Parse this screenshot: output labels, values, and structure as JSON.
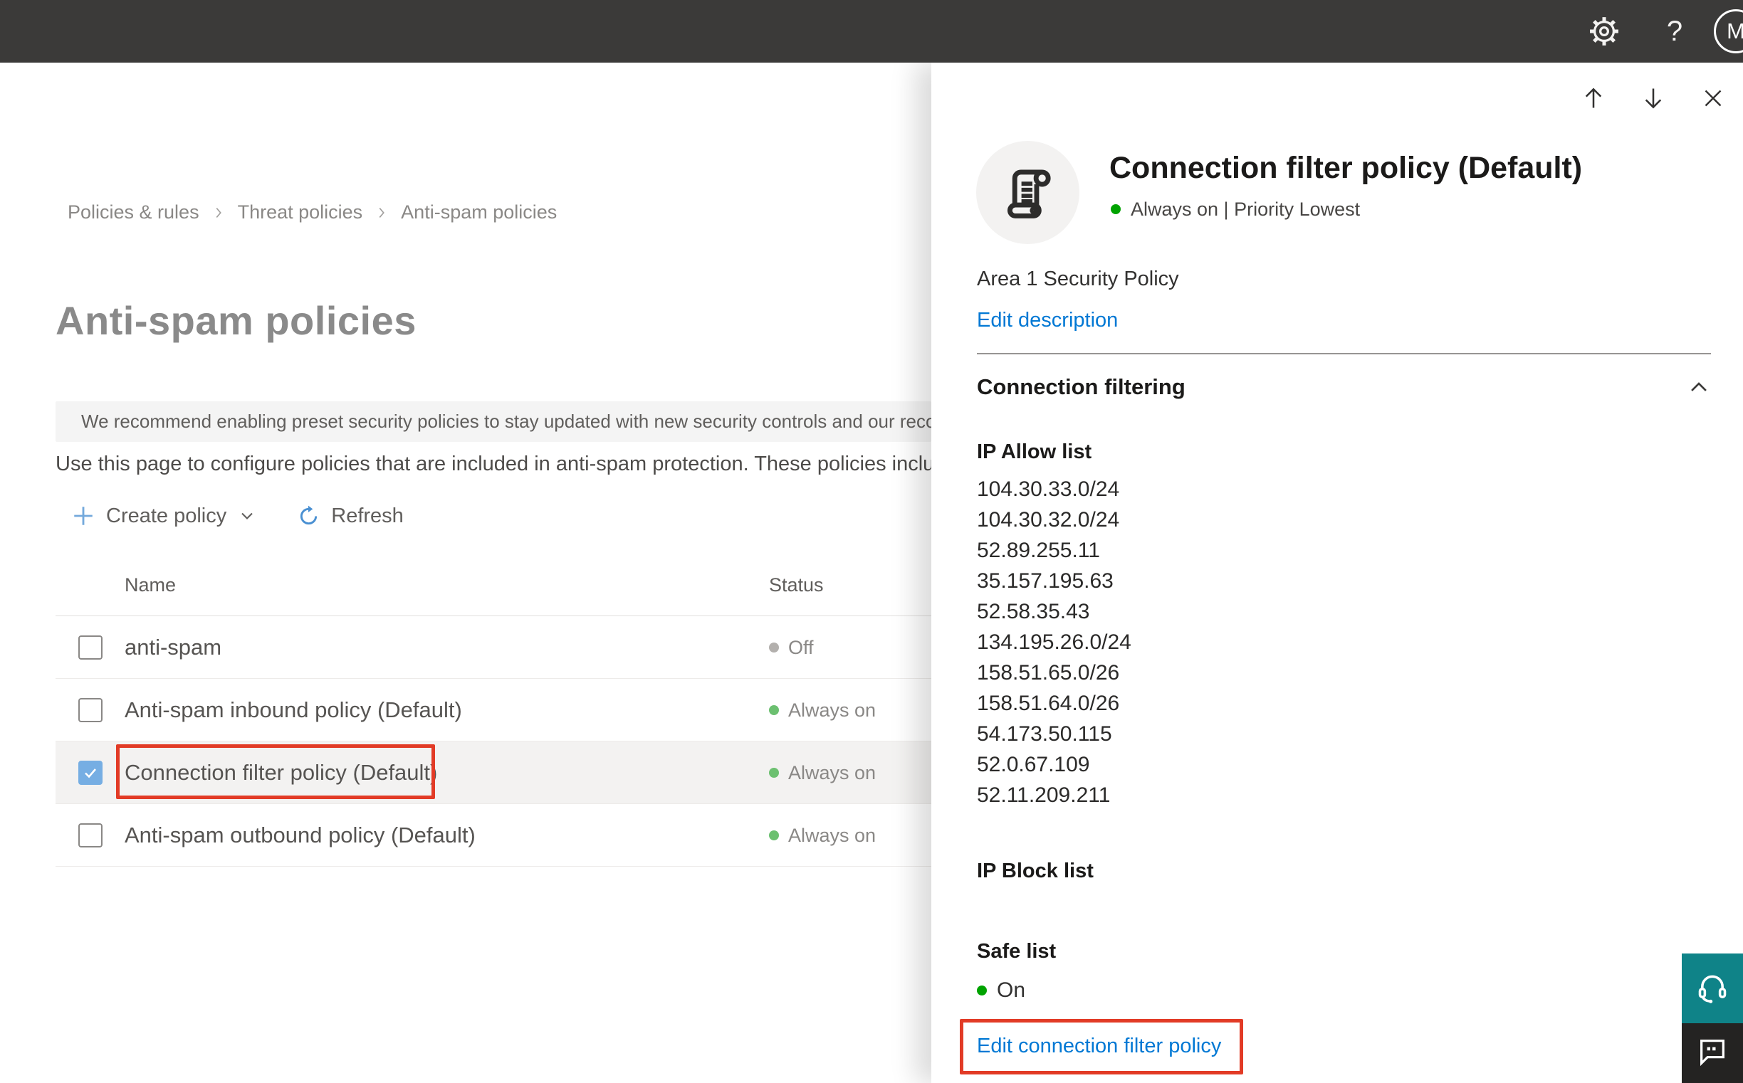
{
  "topbar": {
    "help_label": "?",
    "avatar_initial": "M"
  },
  "breadcrumb": {
    "items": [
      "Policies & rules",
      "Threat policies",
      "Anti-spam policies"
    ]
  },
  "page": {
    "title": "Anti-spam policies",
    "banner_text": "We recommend enabling preset security policies to stay updated with new security controls and our recomme",
    "description": "Use this page to configure policies that are included in anti-spam protection. These policies include"
  },
  "toolbar": {
    "create_label": "Create policy",
    "refresh_label": "Refresh"
  },
  "table": {
    "columns": {
      "name": "Name",
      "status": "Status"
    },
    "rows": [
      {
        "name": "anti-spam",
        "status": "Off",
        "state": "off",
        "checked": false,
        "annotated": false
      },
      {
        "name": "Anti-spam inbound policy (Default)",
        "status": "Always on",
        "state": "on",
        "checked": false,
        "annotated": false
      },
      {
        "name": "Connection filter policy (Default)",
        "status": "Always on",
        "state": "on",
        "checked": true,
        "annotated": true,
        "selected": true
      },
      {
        "name": "Anti-spam outbound policy (Default)",
        "status": "Always on",
        "state": "on",
        "checked": false,
        "annotated": false
      }
    ]
  },
  "panel": {
    "title": "Connection filter policy (Default)",
    "status_line": "Always on | Priority Lowest",
    "description": "Area 1 Security Policy",
    "edit_description_label": "Edit description",
    "section_title": "Connection filtering",
    "ip_allow": {
      "title": "IP Allow list",
      "items": [
        "104.30.33.0/24",
        "104.30.32.0/24",
        "52.89.255.11",
        "35.157.195.63",
        "52.58.35.43",
        "134.195.26.0/24",
        "158.51.65.0/26",
        "158.51.64.0/26",
        "54.173.50.115",
        "52.0.67.109",
        "52.11.209.211"
      ]
    },
    "ip_block": {
      "title": "IP Block list"
    },
    "safe_list": {
      "title": "Safe list",
      "status": "On"
    },
    "edit_link": "Edit connection filter policy"
  },
  "colors": {
    "accent_link": "#0078d4",
    "annotation_red": "#e23b26",
    "status_on_green": "#6cc070",
    "status_off_gray": "#b3b0ad",
    "panel_status_green": "#00a300",
    "checkbox_blue": "#76aee3",
    "topbar_dark": "#3b3a39",
    "support_teal": "#0f8388",
    "feedback_dark": "#242322"
  }
}
